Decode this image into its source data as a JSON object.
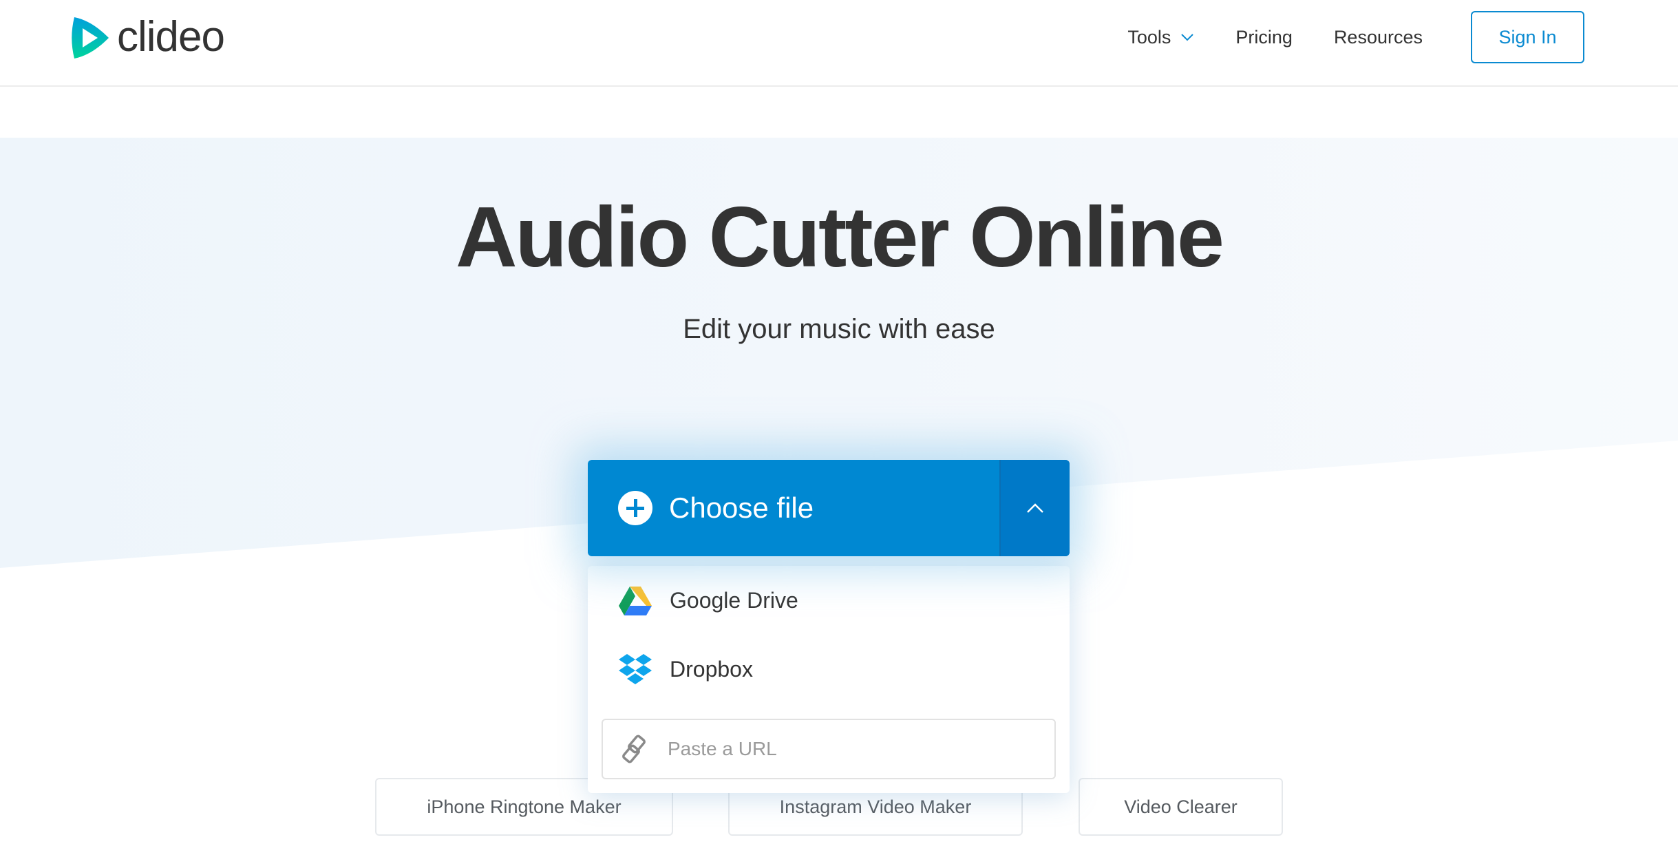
{
  "header": {
    "logo_text": "clideo",
    "nav": [
      {
        "label": "Tools",
        "has_dropdown": true
      },
      {
        "label": "Pricing"
      },
      {
        "label": "Resources"
      }
    ],
    "sign_in_label": "Sign In"
  },
  "hero": {
    "title": "Audio Cutter Online",
    "subtitle": "Edit your music with ease"
  },
  "upload": {
    "choose_label": "Choose file",
    "sources": [
      {
        "label": "Google Drive",
        "icon": "google-drive-icon"
      },
      {
        "label": "Dropbox",
        "icon": "dropbox-icon"
      }
    ],
    "url_placeholder": "Paste a URL",
    "url_value": ""
  },
  "related_tools": [
    {
      "label": "iPhone Ringtone Maker"
    },
    {
      "label": "Instagram Video Maker"
    },
    {
      "label": "Video Clearer"
    }
  ],
  "colors": {
    "accent": "#0088d2",
    "accent_dark": "#0079c8",
    "link": "#0a8ad1",
    "text": "#333333"
  }
}
